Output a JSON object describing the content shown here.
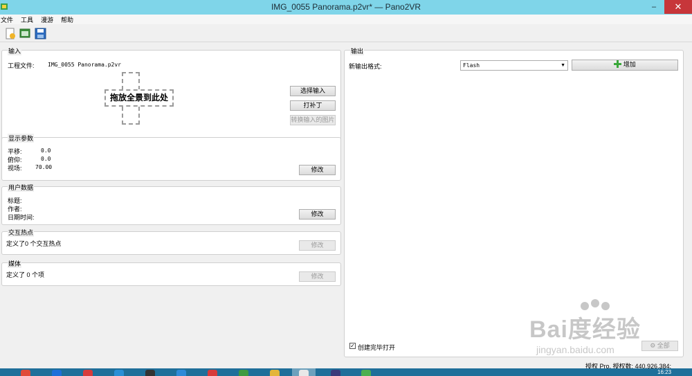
{
  "window": {
    "title": "IMG_0055 Panorama.p2vr* — Pano2VR",
    "minimize": "–",
    "close": "✕"
  },
  "menu": [
    "文件",
    "工具",
    "漫游",
    "帮助"
  ],
  "toolbar": {
    "icons": [
      "new-project-icon",
      "open-project-icon",
      "save-project-icon"
    ]
  },
  "input_group": {
    "title": "输入",
    "project_label": "工程文件:",
    "project_file": "IMG_0055 Panorama.p2vr",
    "drop_text": "拖放全景到此处",
    "select_input": "选择输入",
    "patch": "打补丁",
    "convert_input": "转换输入的图片"
  },
  "display_group": {
    "title": "显示参数",
    "pan_label": "平移:",
    "pan_value": "0.0",
    "tilt_label": "俯仰:",
    "tilt_value": "0.0",
    "fov_label": "视场:",
    "fov_value": "70.00",
    "modify": "修改"
  },
  "user_group": {
    "title": "用户数据",
    "title_label": "标题:",
    "author_label": "作者:",
    "datetime_label": "日期时间:",
    "modify": "修改"
  },
  "hotspot_group": {
    "title": "交互热点",
    "text": "定义了0 个交互热点",
    "modify": "修改"
  },
  "media_group": {
    "title": "媒体",
    "text": "定义了 0 个项",
    "modify": "修改"
  },
  "output_group": {
    "title": "输出",
    "format_label": "新输出格式:",
    "format_value": "Flash",
    "add": "增加",
    "open_after": "创建完毕打开",
    "open_after_checked": true,
    "all": "全部"
  },
  "status": {
    "license": "授权 Pro, 授权数: 440,926,384;"
  },
  "taskbar": {
    "clock": "16:23",
    "apps": [
      "#e04a3a",
      "#1e6fd9",
      "#d83b3b",
      "#2a8fd6",
      "#333333",
      "#2f8ad8",
      "#d73a3a",
      "#3f9a3f",
      "#e3b53b",
      "#e8e8e8",
      "#3a3a7a",
      "#4caf50"
    ]
  },
  "watermark": {
    "brand": "Bai度经验",
    "url": "jingyan.baidu.com"
  },
  "colors": {
    "titlebar": "#7fd5e9",
    "close": "#c7363a",
    "taskbar": "#1f6f9a"
  }
}
